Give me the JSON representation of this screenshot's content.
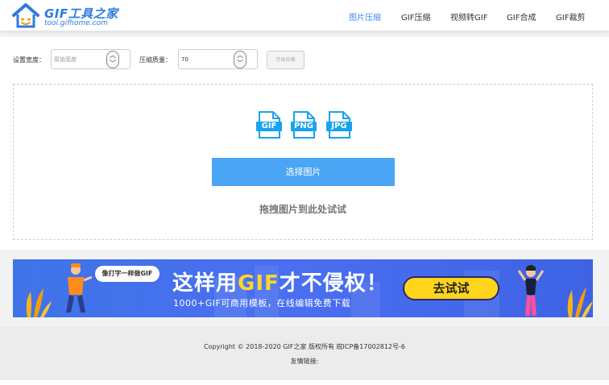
{
  "header": {
    "logo_title": "GIF工具之家",
    "logo_sub": "tool.gifhome.com",
    "nav": [
      {
        "label": "图片压缩",
        "active": true
      },
      {
        "label": "GIF压缩",
        "active": false
      },
      {
        "label": "视频转GIF",
        "active": false
      },
      {
        "label": "GIF合成",
        "active": false
      },
      {
        "label": "GIF裁剪",
        "active": false
      }
    ]
  },
  "settings": {
    "width_label": "设置宽度：",
    "width_placeholder": "原始宽度",
    "quality_label": "压缩质量：",
    "quality_value": "70",
    "compress_button": "开始压缩"
  },
  "dropzone": {
    "file_types": [
      "GIF",
      "PNG",
      "JPG"
    ],
    "select_button": "选择图片",
    "hint": "拖拽图片到此处试试"
  },
  "banner": {
    "bubble": "像打字一样做GIF",
    "headline_pre": "这样用",
    "headline_highlight": "GIF",
    "headline_post": "才不侵权！",
    "subline": "1000+GIF可商用模板，在线编辑免费下载",
    "button": "去试试"
  },
  "footer": {
    "copyright": "Copyright © 2018-2020 GIF之家 版权所有 皖ICP备17002812号-6",
    "links_label": "友情链接:"
  },
  "colors": {
    "accent": "#3d8df5",
    "button_blue": "#4aa6f5",
    "icon_blue": "#1aa3ec",
    "banner_blue": "#4a6ef0",
    "banner_yellow": "#ffd41c"
  }
}
